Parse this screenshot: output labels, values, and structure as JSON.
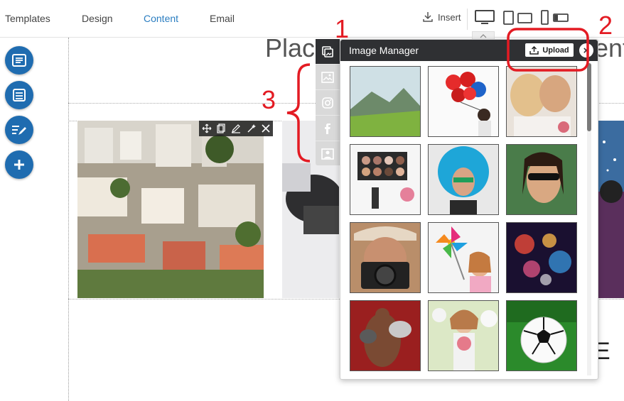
{
  "nav": {
    "items": [
      {
        "label": "Templates"
      },
      {
        "label": "Design"
      },
      {
        "label": "Content"
      },
      {
        "label": "Email"
      }
    ],
    "insert_label": "Insert"
  },
  "canvas": {
    "placeholder_left": "Plac",
    "placeholder_right": "ent",
    "big_letter": "E"
  },
  "image_manager": {
    "title": "Image Manager",
    "upload_label": "Upload",
    "close_label": "×",
    "tabs": [
      "gallery-icon",
      "image-icon",
      "instagram-icon",
      "facebook-icon",
      "portrait-icon"
    ],
    "thumbnails": [
      "mountain-valley",
      "red-balloons",
      "wedding-couple",
      "makeup-palette",
      "blue-afro-wig",
      "woman-sunglasses",
      "woman-camera",
      "girl-pinwheel",
      "bokeh-lights",
      "boxer",
      "flower-woman",
      "soccer-ball"
    ]
  },
  "annotations": {
    "label_1": "1",
    "label_2": "2",
    "label_3": "3"
  },
  "colors": {
    "accent": "#2b7ec1",
    "fab": "#1f6cb0",
    "header": "#2f3033",
    "annotation": "#e31b23"
  }
}
